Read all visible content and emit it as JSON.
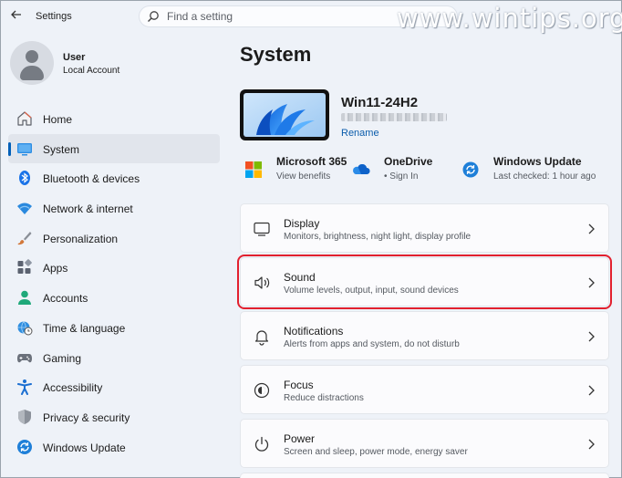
{
  "app": {
    "title": "Settings"
  },
  "search": {
    "placeholder": "Find a setting"
  },
  "watermark": "www.wintips.org",
  "user": {
    "name": "User",
    "account": "Local Account"
  },
  "sidebar": {
    "items": [
      {
        "label": "Home",
        "icon": "home-icon"
      },
      {
        "label": "System",
        "icon": "monitor-icon",
        "active": true
      },
      {
        "label": "Bluetooth & devices",
        "icon": "bluetooth-icon"
      },
      {
        "label": "Network & internet",
        "icon": "wifi-icon"
      },
      {
        "label": "Personalization",
        "icon": "brush-icon"
      },
      {
        "label": "Apps",
        "icon": "apps-icon"
      },
      {
        "label": "Accounts",
        "icon": "person-icon"
      },
      {
        "label": "Time & language",
        "icon": "globe-clock-icon"
      },
      {
        "label": "Gaming",
        "icon": "gamepad-icon"
      },
      {
        "label": "Accessibility",
        "icon": "accessibility-icon"
      },
      {
        "label": "Privacy & security",
        "icon": "shield-icon"
      },
      {
        "label": "Windows Update",
        "icon": "update-icon"
      }
    ]
  },
  "main": {
    "title": "System",
    "device": {
      "name": "Win11-24H2",
      "rename": "Rename"
    },
    "tiles": [
      {
        "title": "Microsoft 365",
        "sub": "View benefits",
        "icon": "microsoft-logo-icon"
      },
      {
        "title": "OneDrive",
        "sub": "• Sign In",
        "icon": "onedrive-icon"
      },
      {
        "title": "Windows Update",
        "sub": "Last checked: 1 hour ago",
        "icon": "windows-update-icon"
      }
    ],
    "cards": [
      {
        "title": "Display",
        "sub": "Monitors, brightness, night light, display profile",
        "icon": "display-icon"
      },
      {
        "title": "Sound",
        "sub": "Volume levels, output, input, sound devices",
        "icon": "speaker-icon",
        "highlighted": true
      },
      {
        "title": "Notifications",
        "sub": "Alerts from apps and system, do not disturb",
        "icon": "bell-icon"
      },
      {
        "title": "Focus",
        "sub": "Reduce distractions",
        "icon": "focus-icon"
      },
      {
        "title": "Power",
        "sub": "Screen and sleep, power mode, energy saver",
        "icon": "power-icon"
      }
    ]
  },
  "colors": {
    "accent": "#005fb8",
    "highlight": "#e2202e",
    "background": "#eef2f8",
    "card": "#fbfbfd"
  }
}
